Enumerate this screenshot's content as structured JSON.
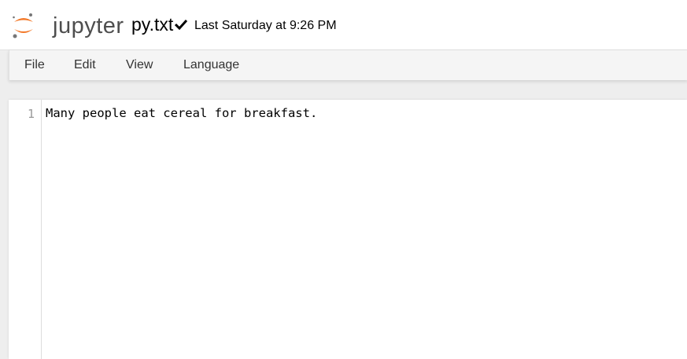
{
  "header": {
    "logo_text": "jupyter",
    "file_name": "py.txt",
    "save_status_icon": "checkmark-icon",
    "last_saved": "Last Saturday at 9:26 PM"
  },
  "menu": [
    "File",
    "Edit",
    "View",
    "Language"
  ],
  "editor": {
    "line_numbers": [
      "1"
    ],
    "lines": [
      "Many people eat cereal for breakfast."
    ]
  },
  "colors": {
    "logo_orange": "#f37726",
    "logo_gray": "#767677"
  }
}
